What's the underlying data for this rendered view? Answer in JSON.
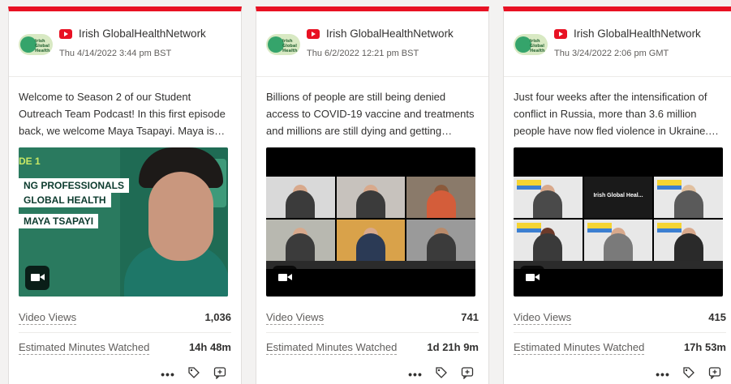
{
  "cards": [
    {
      "channel": "Irish GlobalHealthNetwork",
      "logo_text": "Irish Global Health",
      "date": "Thu 4/14/2022 3:44 pm BST",
      "description": "Welcome to Season 2 of our Student Outreach Team Podcast! In this first episode back, we welcome Maya Tsapayi. Maya is an…",
      "thumbnail_text": {
        "episode": "DE 1",
        "line1": "NG PROFESSIONALS",
        "line2": "GLOBAL HEALTH",
        "name": "MAYA TSAPAYI"
      },
      "metrics": [
        {
          "label": "Video Views",
          "value": "1,036"
        },
        {
          "label": "Estimated Minutes Watched",
          "value": "14h 48m"
        }
      ]
    },
    {
      "channel": "Irish GlobalHealthNetwork",
      "logo_text": "Irish Global Health",
      "date": "Thu 6/2/2022 12:21 pm BST",
      "description": "Billions of people are still being denied access to COVID-19 vaccine and treatments and millions are still dying and getting severely il…",
      "metrics": [
        {
          "label": "Video Views",
          "value": "741"
        },
        {
          "label": "Estimated Minutes Watched",
          "value": "1d 21h 9m"
        }
      ]
    },
    {
      "channel": "Irish GlobalHealthNetwork",
      "logo_text": "Irish Global Health",
      "date": "Thu 3/24/2022 2:06 pm GMT",
      "description": "Just four weeks after the intensification of conflict in Russia, more than 3.6 million people have now fled violence in Ukraine.…",
      "thumbnail_text": {
        "center_title": "Irish Global Heal..."
      },
      "metrics": [
        {
          "label": "Video Views",
          "value": "415"
        },
        {
          "label": "Estimated Minutes Watched",
          "value": "17h 53m"
        }
      ]
    }
  ],
  "actions": {
    "more": "•••",
    "tag": "⌂",
    "comment": "⟳"
  },
  "icons": {
    "platform": "youtube-icon",
    "media": "video-camera-icon"
  },
  "colors": {
    "accent": "#e81123",
    "card_bg": "#ffffff",
    "page_bg": "#f3f2f1"
  }
}
